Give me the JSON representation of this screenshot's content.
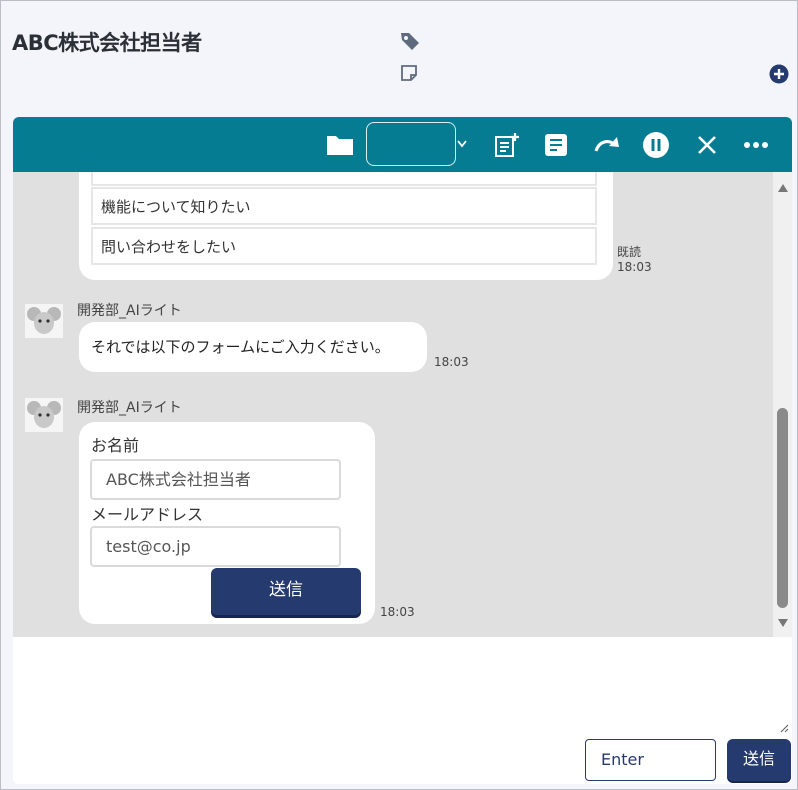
{
  "header": {
    "title": "ABC株式会社担当者",
    "tag_icon": "tag-icon",
    "memo_icon": "sticky-note-icon",
    "add_icon": "plus-circle-icon"
  },
  "toolbar": {
    "icons": [
      "folder-icon",
      "status-select",
      "chevron-down-icon",
      "note-add-icon",
      "document-icon",
      "redo-icon",
      "pause-icon",
      "close-icon",
      "more-icon"
    ],
    "status_value": ""
  },
  "messages": {
    "options": [
      "機能について知りたい",
      "問い合わせをしたい"
    ],
    "read_label": "既読",
    "read_time": "18:03",
    "msg1": {
      "sender": "開発部_AIライト",
      "text": "それでは以下のフォームにご入力ください。",
      "time": "18:03"
    },
    "msg2": {
      "sender": "開発部_AIライト",
      "form": {
        "name_label": "お名前",
        "name_value": "ABC株式会社担当者",
        "email_label": "メールアドレス",
        "email_value": "test@co.jp",
        "submit_label": "送信"
      },
      "time": "18:03"
    }
  },
  "compose": {
    "enter_label": "Enter",
    "send_label": "送信"
  },
  "colors": {
    "toolbar": "#067c92",
    "primary": "#253a6e",
    "chat_bg": "#e0e0e0"
  }
}
